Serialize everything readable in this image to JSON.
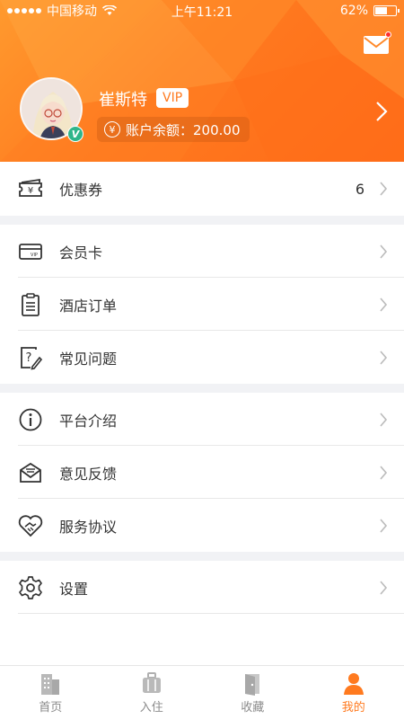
{
  "status_bar": {
    "carrier": "中国移动",
    "time": "上午11:21",
    "battery": "62%",
    "battery_level": 0.62
  },
  "profile": {
    "name": "崔斯特",
    "vip": "VIP",
    "balance_label": "账户余额：200.00",
    "currency_symbol": "¥",
    "badge": "V"
  },
  "menu": {
    "coupon": {
      "label": "优惠券",
      "count": "6"
    },
    "member_card": {
      "label": "会员卡"
    },
    "hotel_order": {
      "label": "酒店订单"
    },
    "faq": {
      "label": "常见问题"
    },
    "about": {
      "label": "平台介绍"
    },
    "feedback": {
      "label": "意见反馈"
    },
    "agreement": {
      "label": "服务协议"
    },
    "settings": {
      "label": "设置"
    }
  },
  "tabs": [
    {
      "label": "首页",
      "icon": "building-icon"
    },
    {
      "label": "入住",
      "icon": "luggage-icon"
    },
    {
      "label": "收藏",
      "icon": "door-icon"
    },
    {
      "label": "我的",
      "icon": "person-icon",
      "active": true
    }
  ],
  "colors": {
    "accent": "#ff7a1f",
    "section_gap": "#f1f2f5",
    "text": "#333333",
    "inactive": "#8a8a8a"
  }
}
